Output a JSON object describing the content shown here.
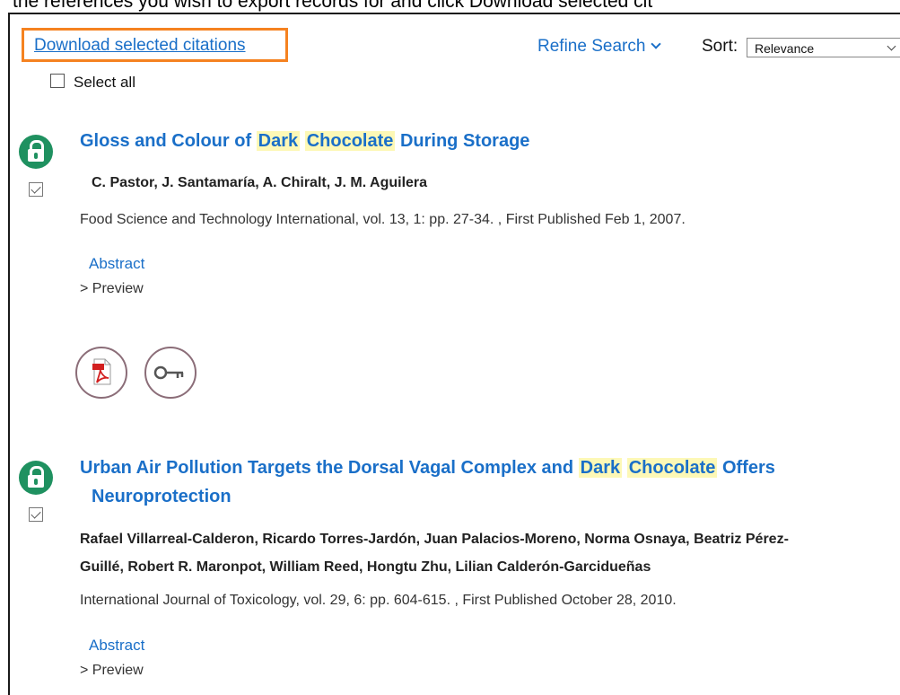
{
  "instruction": "the references you wish to export records for and click Download selected cit",
  "toolbar": {
    "download_label": "Download selected citations",
    "select_all_label": "Select all",
    "refine_label": "Refine Search",
    "sort_label": "Sort:",
    "sort_value": "Relevance"
  },
  "results": [
    {
      "title_parts": [
        "Gloss and Colour of ",
        "Dark",
        "Chocolate",
        " During Storage"
      ],
      "authors": "C. Pastor, J. Santamaría, A. Chiralt, J. M. Aguilera",
      "journal": "Food Science and Technology International, vol. 13, 1: pp. 27-34. , First Published Feb 1, 2007.",
      "abstract_label": "Abstract",
      "preview_label": "> Preview",
      "selected": true,
      "open_access": true
    },
    {
      "title_parts": [
        "Urban Air Pollution Targets the Dorsal Vagal Complex and ",
        "Dark",
        "Chocolate",
        " Offers",
        "Neuroprotection"
      ],
      "authors_line1": "Rafael Villarreal-Calderon, Ricardo Torres-Jardón, Juan Palacios-Moreno, Norma Osnaya, Beatriz Pérez-",
      "authors_line2": "Guillé, Robert R. Maronpot, William Reed, Hongtu Zhu, Lilian Calderón-Garcidueñas",
      "journal": "International Journal of Toxicology, vol. 29, 6: pp. 604-615. , First Published October 28, 2010.",
      "abstract_label": "Abstract",
      "preview_label": "> Preview",
      "selected": true,
      "open_access": true
    }
  ],
  "colors": {
    "link": "#1a6fc8",
    "highlight": "#fdf8b6",
    "open_access": "#1f9160",
    "focus_box": "#f58220",
    "action_circle": "#8b6d78"
  },
  "icons": [
    "open-access-lock-icon",
    "pdf-icon",
    "key-icon",
    "chevron-down-icon",
    "checkbox-icon"
  ]
}
